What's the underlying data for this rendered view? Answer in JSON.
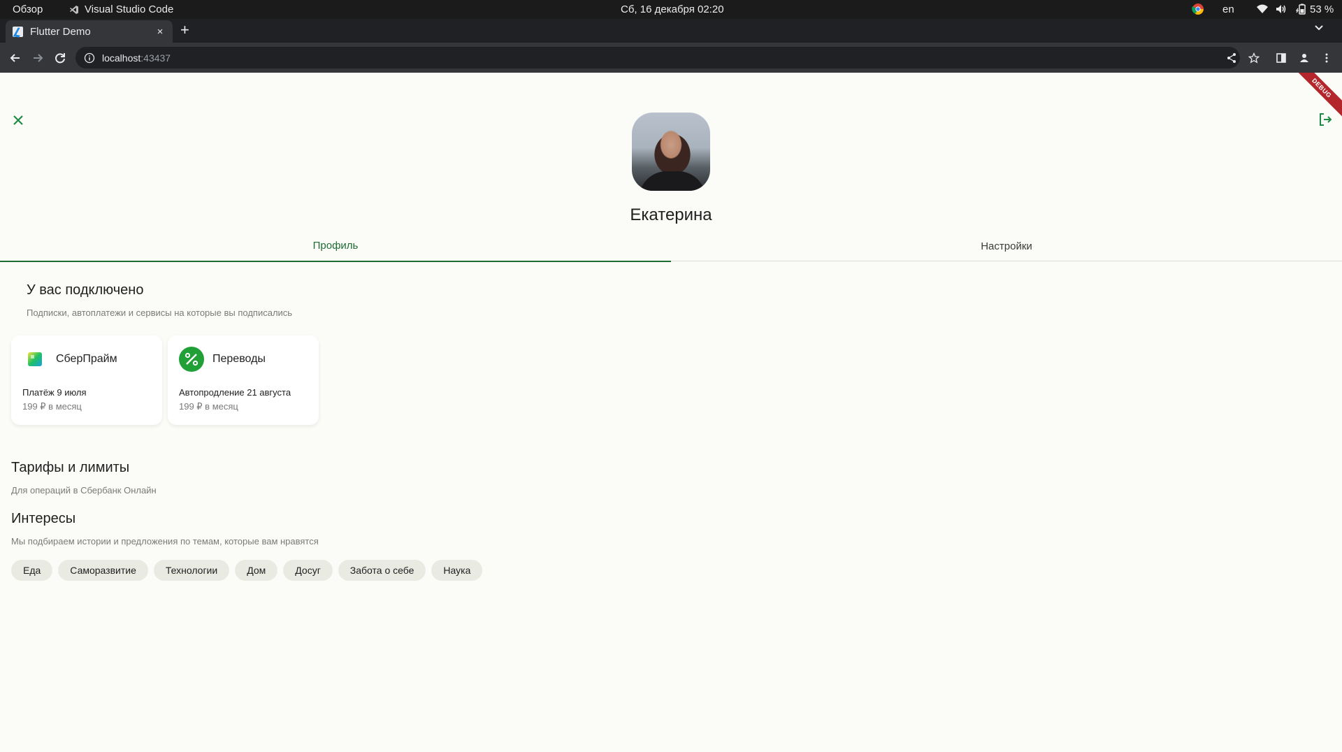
{
  "os_bar": {
    "overview": "Обзор",
    "active_app": "Visual Studio Code",
    "clock": "Сб, 16 декабря  02:20",
    "language": "en",
    "battery": "53 %"
  },
  "browser": {
    "tab_title": "Flutter Demo",
    "tab_close": "×",
    "new_tab": "+",
    "url_host": "localhost",
    "url_port": ":43437"
  },
  "app": {
    "debug_banner": "DEBUG",
    "user_name": "Екатерина",
    "tabs": [
      {
        "label": "Профиль",
        "active": true
      },
      {
        "label": "Настройки",
        "active": false
      }
    ],
    "connected": {
      "title": "У вас подключено",
      "subtitle": "Подписки, автоплатежи и сервисы на которые вы подписались",
      "cards": [
        {
          "icon": "sberprime-icon",
          "name": "СберПрайм",
          "line1": "Платёж 9 июля",
          "line2": "199 ₽ в месяц"
        },
        {
          "icon": "percent-icon",
          "name": "Переводы",
          "line1": "Автопродление 21 августа",
          "line2": "199 ₽ в месяц"
        }
      ]
    },
    "tariffs": {
      "title": "Тарифы и лимиты",
      "subtitle": "Для операций в Сбербанк Онлайн"
    },
    "interests": {
      "title": "Интересы",
      "subtitle": "Мы подбираем истории и предложения по темам, которые вам нравятся",
      "chips": [
        "Еда",
        "Саморазвитие",
        "Технологии",
        "Дом",
        "Досуг",
        "Забота о себе",
        "Наука"
      ]
    }
  },
  "colors": {
    "accent": "#1e6b34",
    "background": "#fbfcf7",
    "chip": "#e9ebe3",
    "icon_green": "#21a038"
  }
}
